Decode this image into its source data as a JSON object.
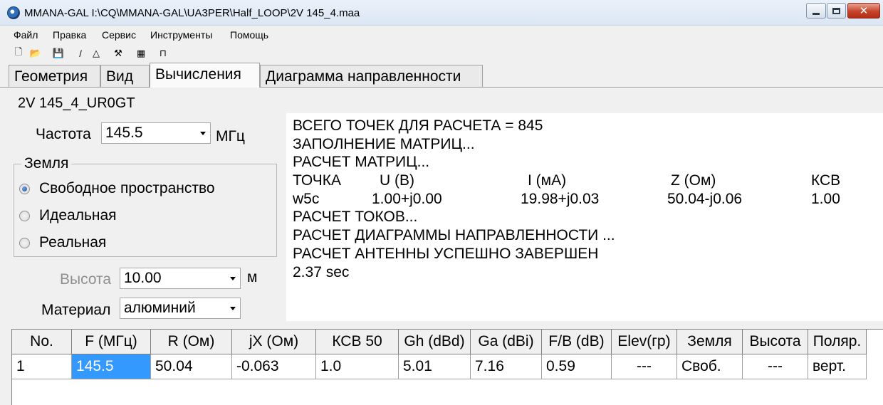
{
  "window": {
    "title": "MMANA-GAL I:\\CQ\\MMANA-GAL\\UA3PER\\Half_LOOP\\2V 145_4.maa",
    "min_label": "minimize",
    "close_glyph": "✕"
  },
  "menu": [
    "Файл",
    "Правка",
    "Сервис",
    "Инструменты",
    "Помощь"
  ],
  "toolbar": {
    "icons": [
      "new-file-icon",
      "open-folder-icon",
      "save-disk-icon",
      "draw-line-icon",
      "triangle-icon",
      "tools-icon",
      "calculator-icon",
      "network-icon"
    ],
    "glyphs": [
      "🗋",
      "📂",
      "💾",
      "/",
      "△",
      "⚒",
      "▦",
      "⊓"
    ]
  },
  "tabs": [
    "Геометрия",
    "Вид",
    "Вычисления",
    "Диаграмма направленности"
  ],
  "active_tab": 2,
  "project_name": "2V 145_4_UR0GT",
  "frequency": {
    "label": "Частота",
    "value": "145.5",
    "unit": "МГц"
  },
  "ground": {
    "title": "Земля",
    "options": [
      "Свободное пространство",
      "Идеальная",
      "Реальная"
    ],
    "selected": 0
  },
  "height": {
    "label": "Высота",
    "value": "10.00",
    "unit": "м"
  },
  "material": {
    "label": "Материал",
    "value": "алюминий"
  },
  "log": {
    "lines": [
      "ВСЕГО ТОЧЕК ДЛЯ РАСЧЕТА = 845",
      "ЗАПОЛНЕНИЕ МАТРИЦ...",
      "РАСЧЕТ МАТРИЦ..."
    ],
    "header": [
      "ТОЧКА",
      "U (В)",
      "I (мА)",
      "Z (Ом)",
      "КСВ"
    ],
    "row": [
      "w5c",
      "1.00+j0.00",
      "19.98+j0.03",
      "50.04-j0.06",
      "1.00"
    ],
    "tail": [
      "РАСЧЕТ ТОКОВ...",
      "РАСЧЕТ ДИАГРАММЫ НАПРАВЛЕННОСТИ ...",
      "РАСЧЕТ АНТЕННЫ УСПЕШНО ЗАВЕРШЕН",
      "2.37 sec"
    ]
  },
  "results": {
    "columns": [
      "No.",
      "F (МГц)",
      "R (Ом)",
      "jX (Ом)",
      "КСВ 50",
      "Gh (dBd)",
      "Ga (dBi)",
      "F/B (dB)",
      "Elev(гр)",
      "Земля",
      "Высота",
      "Поляр."
    ],
    "rows": [
      [
        "1",
        "145.5",
        "50.04",
        "-0.063",
        "1.0",
        "5.01",
        "7.16",
        "0.59",
        "---",
        "Своб.",
        "---",
        "верт."
      ]
    ]
  }
}
